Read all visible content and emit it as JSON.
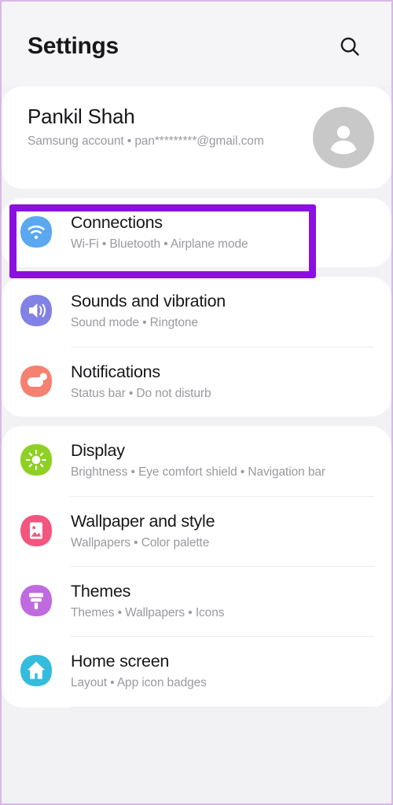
{
  "header": {
    "title": "Settings",
    "search_icon": "search-icon"
  },
  "profile": {
    "name": "Pankil Shah",
    "subtitle": "Samsung account  •  pan*********@gmail.com",
    "avatar_icon": "person-avatar-icon"
  },
  "annotation": {
    "target": "Connections",
    "color": "#8b10e0"
  },
  "groups": [
    {
      "name": "connections-group",
      "items": [
        {
          "title": "Connections",
          "subtitle": "Wi-Fi  •  Bluetooth  •  Airplane mode",
          "icon": "wifi-icon",
          "icon_color": "#5aa8f0"
        }
      ]
    },
    {
      "name": "sound-notifications-group",
      "items": [
        {
          "title": "Sounds and vibration",
          "subtitle": "Sound mode  •  Ringtone",
          "icon": "speaker-icon",
          "icon_color": "#8181e6"
        },
        {
          "title": "Notifications",
          "subtitle": "Status bar  •  Do not disturb",
          "icon": "notification-bubble-icon",
          "icon_color": "#f58170"
        }
      ]
    },
    {
      "name": "personalization-group",
      "items": [
        {
          "title": "Display",
          "subtitle": "Brightness  •  Eye comfort shield  •  Navigation bar",
          "icon": "brightness-sun-icon",
          "icon_color": "#8ed024"
        },
        {
          "title": "Wallpaper and style",
          "subtitle": "Wallpapers  •  Color palette",
          "icon": "photo-image-icon",
          "icon_color": "#f2567e"
        },
        {
          "title": "Themes",
          "subtitle": "Themes  •  Wallpapers  •  Icons",
          "icon": "paint-brush-icon",
          "icon_color": "#c06ae0"
        },
        {
          "title": "Home screen",
          "subtitle": "Layout  •  App icon badges",
          "icon": "home-house-icon",
          "icon_color": "#34bcdd"
        }
      ]
    }
  ]
}
